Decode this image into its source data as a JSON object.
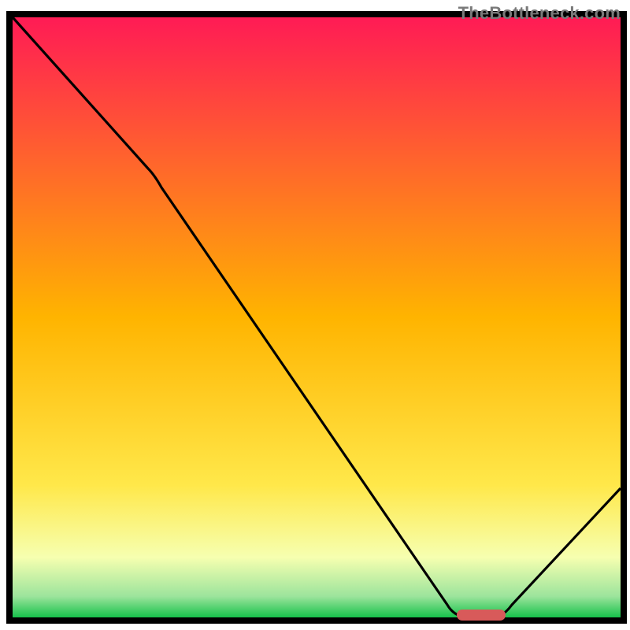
{
  "watermark": "TheBottleneck.com",
  "chart_data": {
    "type": "line",
    "title": "",
    "xlabel": "",
    "ylabel": "",
    "xlim": [
      0,
      100
    ],
    "ylim": [
      0,
      100
    ],
    "grid": false,
    "legend": false,
    "x": [
      0,
      22,
      74,
      79,
      100
    ],
    "values": [
      100,
      75,
      0,
      0,
      22
    ],
    "series_name": "bottleneck-curve",
    "marker": {
      "name": "target-range",
      "x_start": 73,
      "x_end": 81,
      "color": "#d85a5a"
    },
    "gradient_stops": [
      {
        "offset": 0.0,
        "color": "#ff1b55"
      },
      {
        "offset": 0.5,
        "color": "#ffb400"
      },
      {
        "offset": 0.78,
        "color": "#ffe84a"
      },
      {
        "offset": 0.9,
        "color": "#f6ffb0"
      },
      {
        "offset": 0.965,
        "color": "#9ce49c"
      },
      {
        "offset": 1.0,
        "color": "#17c24b"
      }
    ]
  }
}
